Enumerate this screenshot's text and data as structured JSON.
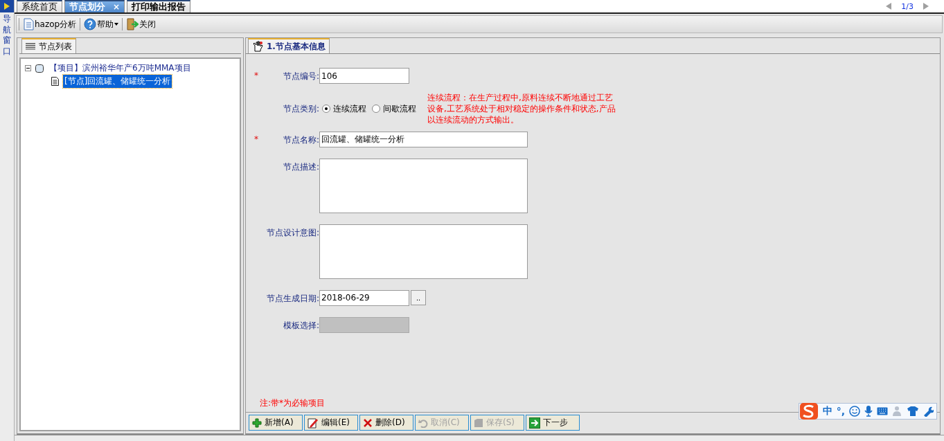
{
  "nav_strip": {
    "label": "导航窗口"
  },
  "tabs": [
    {
      "label": "系统首页",
      "selected": false
    },
    {
      "label": "节点划分",
      "selected": true,
      "close": "×"
    },
    {
      "label": "打印输出报告",
      "selected": false
    }
  ],
  "pager": {
    "text": "1/3"
  },
  "toolbar": [
    {
      "label": "hazop分析",
      "dropdown": false
    },
    {
      "label": "帮助",
      "dropdown": true
    },
    {
      "label": "关闭",
      "dropdown": false
    }
  ],
  "left_panel": {
    "tab": "节点列表",
    "tree": [
      {
        "label": "【项目】滨州裕华年产6万吨MMA项目",
        "expanded": true,
        "selected": false,
        "children": [
          {
            "label": "[节点]回流罐、储罐统一分析",
            "selected": true
          }
        ]
      }
    ]
  },
  "right_panel": {
    "tab": "1.节点基本信息",
    "fields": [
      {
        "kind": "text",
        "label": "节点编号:",
        "required_mark": "*",
        "value": "106"
      },
      {
        "kind": "radio",
        "label": "节点类别:",
        "options": [
          {
            "label": "连续流程",
            "selected": true
          },
          {
            "label": "间歇流程",
            "selected": false
          }
        ],
        "hint": "连续流程：在生产过程中,原料连续不断地通过工艺设备,工艺系统处于相对稳定的操作条件和状态,产品以连续流动的方式输出。"
      },
      {
        "kind": "text",
        "label": "节点名称:",
        "required_mark": "*",
        "value": "回流罐、储罐统一分析"
      },
      {
        "kind": "textarea",
        "label": "节点描述:"
      },
      {
        "kind": "textarea",
        "label": "节点设计意图:"
      },
      {
        "kind": "date",
        "label": "节点生成日期:",
        "value": "2018-06-29",
        "button": ".."
      },
      {
        "kind": "select",
        "label": "模板选择:",
        "disabled": true
      }
    ],
    "note": "注:带*为必输项目",
    "buttons": [
      {
        "label": "新增(A)",
        "disabled": false
      },
      {
        "label": "编辑(E)",
        "disabled": false
      },
      {
        "label": "删除(D)",
        "disabled": false
      },
      {
        "label": "取消(C)",
        "disabled": true
      },
      {
        "label": "保存(S)",
        "disabled": true
      },
      {
        "label": "下一步",
        "disabled": false
      }
    ]
  },
  "ime_bar": {
    "items": [
      "中",
      "°,"
    ]
  }
}
